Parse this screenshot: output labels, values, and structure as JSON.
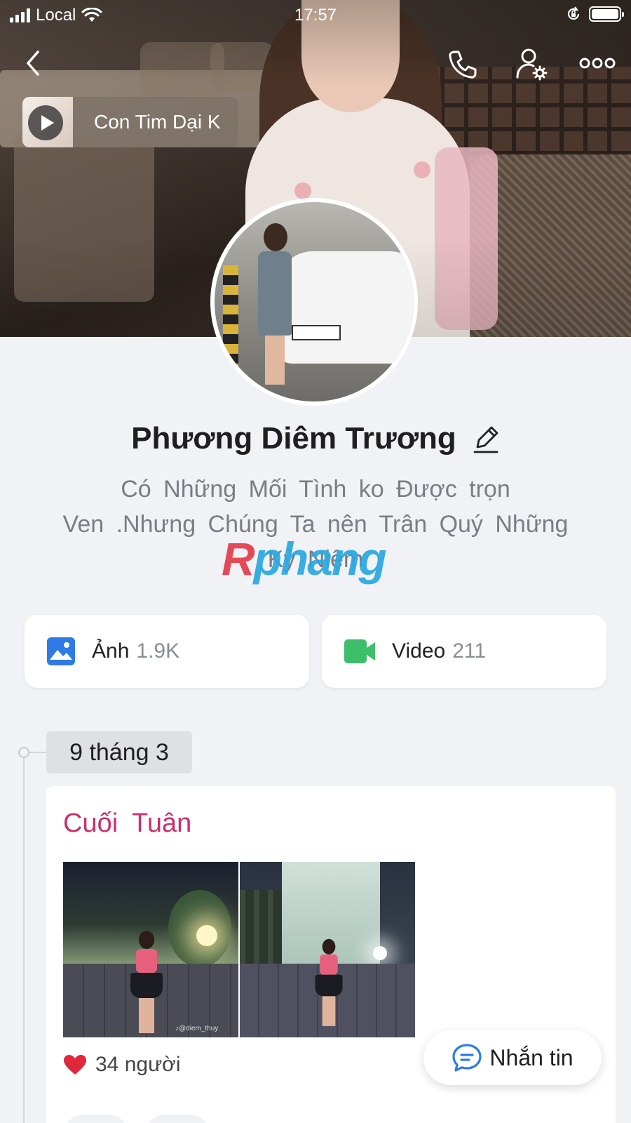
{
  "status_bar": {
    "carrier": "Local",
    "time": "17:57"
  },
  "music": {
    "title": "Con Tim Dại K"
  },
  "profile": {
    "name": "Phương Diêm Trương",
    "bio_lines": [
      "Có  Những  Mối  Tình  ko  Được  trọn",
      "Ven .Nhưng  Chúng  Ta nên  Trân Quý  Những",
      "Kỷ  Niệm"
    ]
  },
  "watermark": {
    "first": "R",
    "rest": "phang"
  },
  "stats": {
    "photos_label": "Ảnh",
    "photos_count": "1.9K",
    "videos_label": "Video",
    "videos_count": "211"
  },
  "timeline": {
    "date": "9 tháng 3",
    "post": {
      "title": "Cuối  Tuân",
      "likes": "34 người",
      "photo_caption": "♪@diem_thuy"
    }
  },
  "message_button": {
    "label": "Nhắn tin"
  },
  "colors": {
    "accent_blue": "#2e7be6",
    "video_green": "#3dbe6a",
    "post_title_pink": "#c9306b",
    "heart_red": "#e0283c"
  },
  "icons": [
    "back-icon",
    "phone-icon",
    "user-settings-icon",
    "more-icon",
    "play-icon",
    "edit-icon",
    "image-icon",
    "video-icon",
    "heart-icon",
    "chat-bubble-icon",
    "wifi-icon",
    "orientation-lock-icon",
    "battery-icon"
  ]
}
